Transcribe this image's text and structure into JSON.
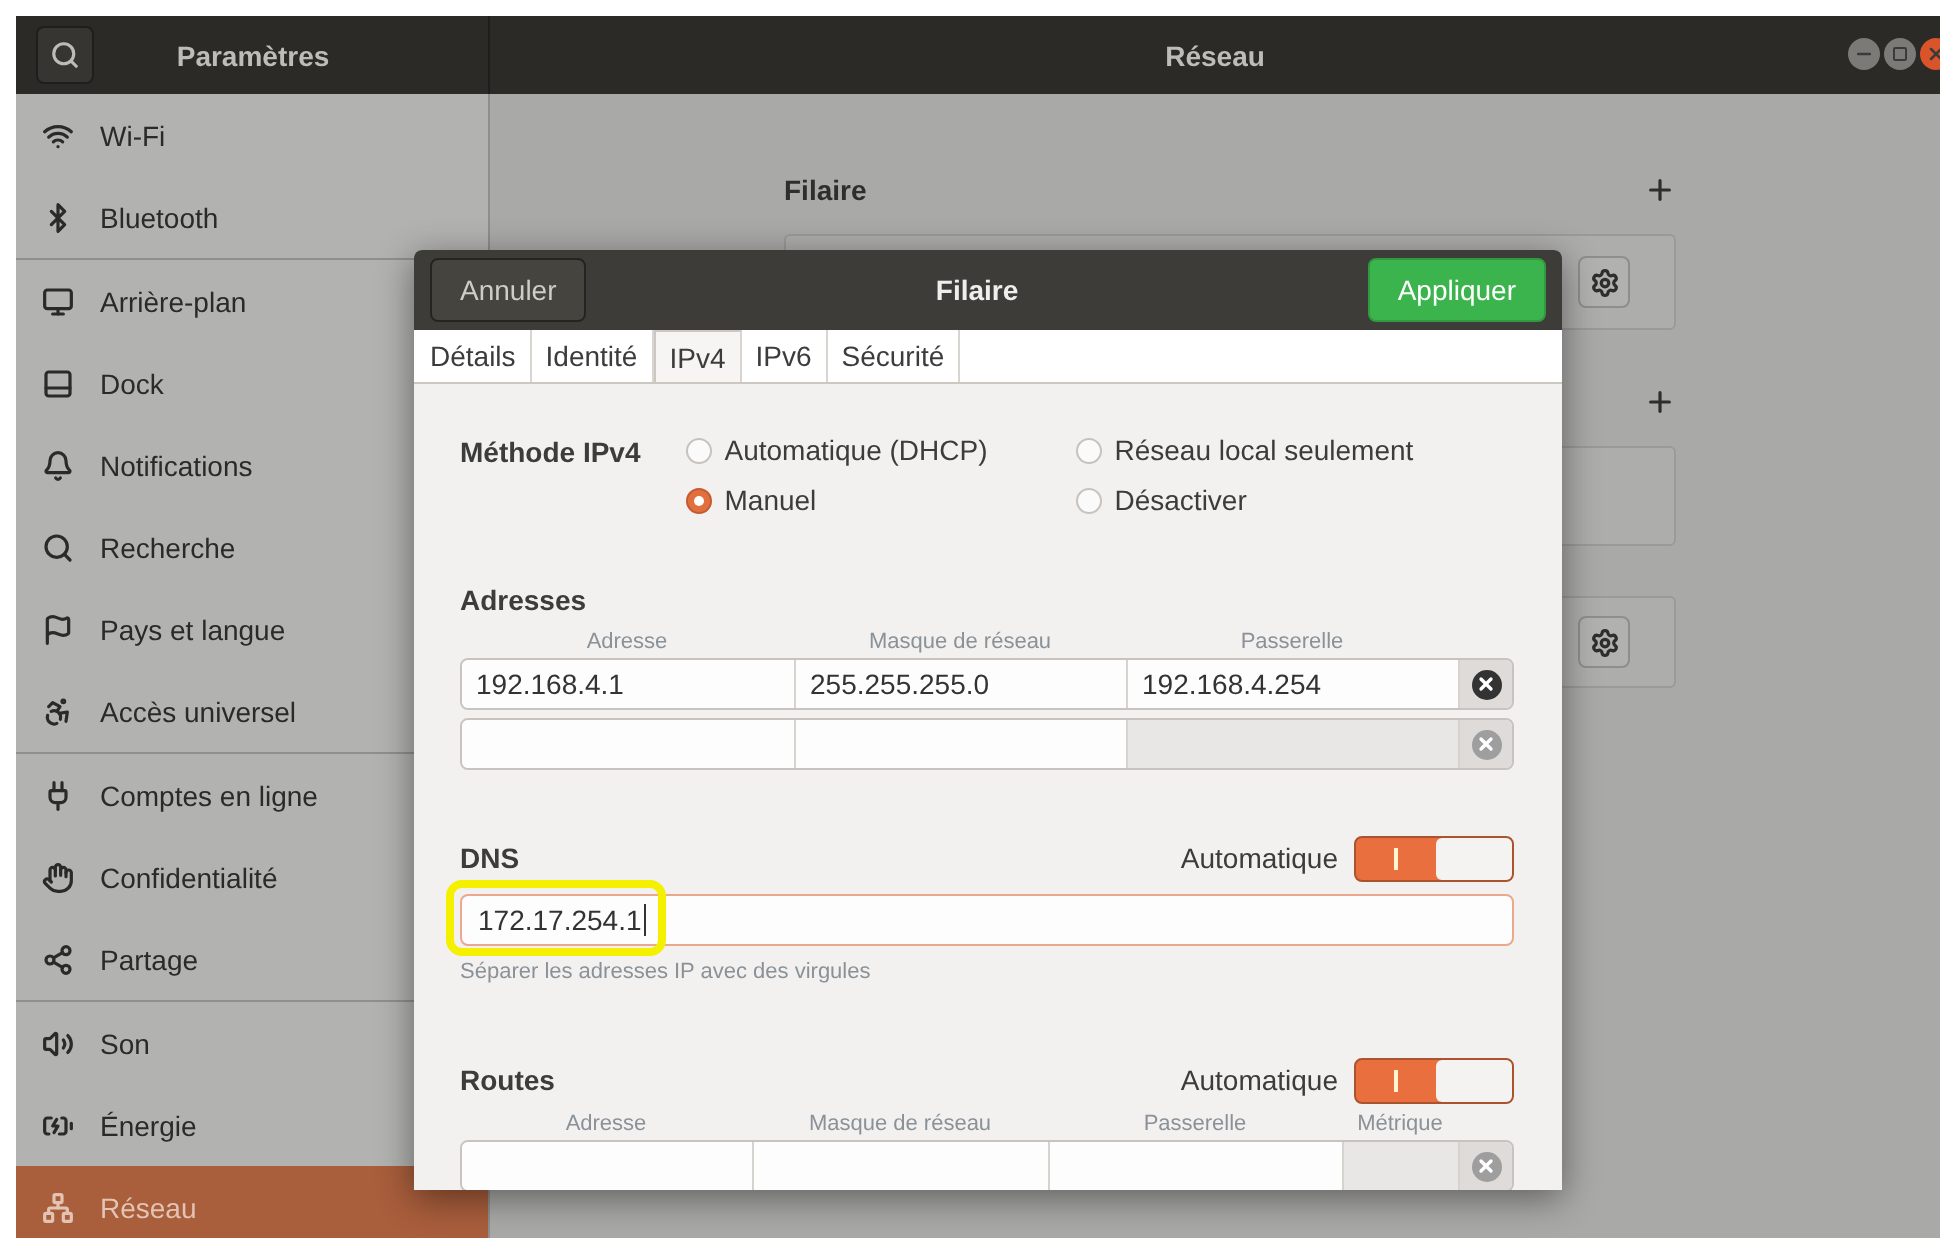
{
  "window": {
    "sidebar_title": "Paramètres",
    "title": "Réseau"
  },
  "sidebar": {
    "groups": [
      [
        {
          "label": "Wi-Fi",
          "selected": false
        },
        {
          "label": "Bluetooth",
          "selected": false
        }
      ],
      [
        {
          "label": "Arrière-plan",
          "selected": false
        },
        {
          "label": "Dock",
          "selected": false
        },
        {
          "label": "Notifications",
          "selected": false
        },
        {
          "label": "Recherche",
          "selected": false
        },
        {
          "label": "Pays et langue",
          "selected": false
        },
        {
          "label": "Accès universel",
          "selected": false
        }
      ],
      [
        {
          "label": "Comptes en ligne",
          "selected": false
        },
        {
          "label": "Confidentialité",
          "selected": false
        },
        {
          "label": "Partage",
          "selected": false
        }
      ],
      [
        {
          "label": "Son",
          "selected": false
        },
        {
          "label": "Énergie",
          "selected": false
        },
        {
          "label": "Réseau",
          "selected": true
        }
      ]
    ]
  },
  "network": {
    "section_title": "Filaire"
  },
  "dialog": {
    "cancel": "Annuler",
    "title": "Filaire",
    "apply": "Appliquer",
    "tabs": [
      {
        "label": "Détails",
        "selected": false
      },
      {
        "label": "Identité",
        "selected": false
      },
      {
        "label": "IPv4",
        "selected": true
      },
      {
        "label": "IPv6",
        "selected": false
      },
      {
        "label": "Sécurité",
        "selected": false
      }
    ],
    "method": {
      "label": "Méthode IPv4",
      "options": [
        {
          "label": "Automatique (DHCP)",
          "selected": false
        },
        {
          "label": "Réseau local seulement",
          "selected": false
        },
        {
          "label": "Manuel",
          "selected": true
        },
        {
          "label": "Désactiver",
          "selected": false
        }
      ]
    },
    "addresses": {
      "title": "Adresses",
      "columns": [
        "Adresse",
        "Masque de réseau",
        "Passerelle"
      ],
      "rows": [
        {
          "cells": [
            "192.168.4.1",
            "255.255.255.0",
            "192.168.4.254"
          ],
          "disabled": false
        },
        {
          "cells": [],
          "disabled": true
        }
      ]
    },
    "dns": {
      "title": "DNS",
      "automatic_label": "Automatique",
      "on": true,
      "value": "172.17.254.1",
      "hint": "Séparer les adresses IP avec des virgules"
    },
    "routes": {
      "title": "Routes",
      "automatic_label": "Automatique",
      "on": true,
      "columns": [
        "Adresse",
        "Masque de réseau",
        "Passerelle",
        "Métrique"
      ],
      "rows": [
        {
          "cells": [],
          "disabled": true
        }
      ]
    }
  }
}
